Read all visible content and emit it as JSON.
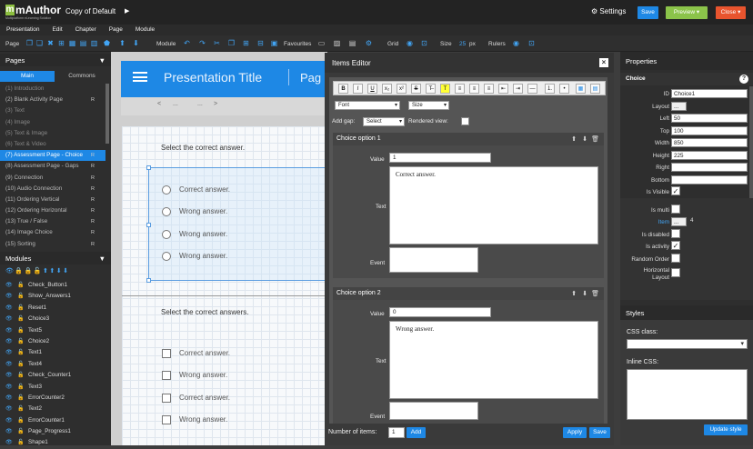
{
  "app": {
    "logo_brand": "mAuthor",
    "logo_sub": "Multiplatform eLearning Solution",
    "doc_title": "Copy of Default",
    "settings_label": "Settings",
    "save_label": "Save",
    "preview_label": "Preview",
    "close_label": "Close"
  },
  "menu": [
    "Presentation",
    "Edit",
    "Chapter",
    "Page",
    "Module"
  ],
  "toolbar": {
    "page_label": "Page",
    "module_label": "Module",
    "favourites_label": "Favourites",
    "grid_label": "Grid",
    "size_label": "Size",
    "size_value": "25",
    "size_unit": "px",
    "rulers_label": "Rulers"
  },
  "pages_panel": {
    "title": "Pages",
    "tab_main": "Main",
    "tab_commons": "Commons",
    "items": [
      {
        "label": "(1) Introduction",
        "r": "",
        "dim": true
      },
      {
        "label": "(2) Blank Activity Page",
        "r": "R",
        "dim": false
      },
      {
        "label": "(3) Text",
        "r": "",
        "dim": true
      },
      {
        "label": "(4) Image",
        "r": "",
        "dim": true
      },
      {
        "label": "(5) Text & Image",
        "r": "",
        "dim": true
      },
      {
        "label": "(6) Text & Video",
        "r": "",
        "dim": true
      },
      {
        "label": "(7) Assessment Page - Choice",
        "r": "R",
        "dim": false,
        "selected": true
      },
      {
        "label": "(8) Assessment Page - Gaps",
        "r": "R",
        "dim": false
      },
      {
        "label": "(9) Connection",
        "r": "R",
        "dim": false
      },
      {
        "label": "(10) Audio Connection",
        "r": "R",
        "dim": false
      },
      {
        "label": "(11) Ordering Vertical",
        "r": "R",
        "dim": false
      },
      {
        "label": "(12) Ordering Horizontal",
        "r": "R",
        "dim": false
      },
      {
        "label": "(13) True / False",
        "r": "R",
        "dim": false
      },
      {
        "label": "(14) Image Choice",
        "r": "R",
        "dim": false
      },
      {
        "label": "(15) Sorting",
        "r": "R",
        "dim": false
      }
    ]
  },
  "modules_panel": {
    "title": "Modules",
    "items": [
      "Check_Button1",
      "Show_Answers1",
      "Reset1",
      "Choice3",
      "Text5",
      "Choice2",
      "Text1",
      "Text4",
      "Check_Counter1",
      "Text3",
      "ErrorCounter2",
      "Text2",
      "ErrorCounter1",
      "Page_Progress1",
      "Shape1"
    ]
  },
  "canvas": {
    "presentation_title": "Presentation Title",
    "pagination": "Pag",
    "nav_prev": "<",
    "nav_dots1": "...",
    "nav_dots2": "...",
    "nav_next": ">",
    "q1": "Select the correct answer.",
    "q1_options": [
      "Correct answer.",
      "Wrong answer.",
      "Wrong answer.",
      "Wrong answer."
    ],
    "q2": "Select the correct answers.",
    "q2_options": [
      "Correct answer.",
      "Wrong answer.",
      "Correct answer.",
      "Wrong answer."
    ]
  },
  "editor": {
    "title": "Items Editor",
    "close": "×",
    "font_select": "Font",
    "size_select": "Size",
    "add_gap_label": "Add gap:",
    "add_gap_value": "Select",
    "rendered_view_label": "Rendered view:",
    "value_label": "Value",
    "text_label": "Text",
    "event_label": "Event",
    "option1": {
      "title": "Choice option 1",
      "value": "1",
      "text": "Correct answer."
    },
    "option2": {
      "title": "Choice option 2",
      "value": "0",
      "text": "Wrong answer."
    },
    "number_items_label": "Number of items:",
    "number_items_value": "1",
    "add_label": "Add",
    "apply_label": "Apply",
    "save_label": "Save"
  },
  "properties": {
    "title": "Properties",
    "section": "Choice",
    "help": "?",
    "id_label": "ID",
    "id_value": "Choice1",
    "layout_label": "Layout",
    "layout_value": "...",
    "left_label": "Left",
    "left_value": "50",
    "top_label": "Top",
    "top_value": "100",
    "width_label": "Width",
    "width_value": "850",
    "height_label": "Height",
    "height_value": "225",
    "right_label": "Right",
    "right_value": "",
    "bottom_label": "Bottom",
    "bottom_value": "",
    "visible_label": "Is Visible",
    "multi_label": "Is multi",
    "item_label": "Item",
    "item_btn": "...",
    "item_count": "4",
    "disabled_label": "Is disabled",
    "activity_label": "Is activity",
    "random_label": "Random Order",
    "horizontal_label_1": "Horizontal",
    "horizontal_label_2": "Layout",
    "check": "✓",
    "styles_title": "Styles",
    "css_class_label": "CSS class:",
    "inline_css_label": "Inline CSS:",
    "update_style": "Update style"
  },
  "colors": {
    "accent": "#1e88e5",
    "preview": "#8bc34a",
    "close": "#e8542e",
    "logo": "#8cbf3f"
  }
}
